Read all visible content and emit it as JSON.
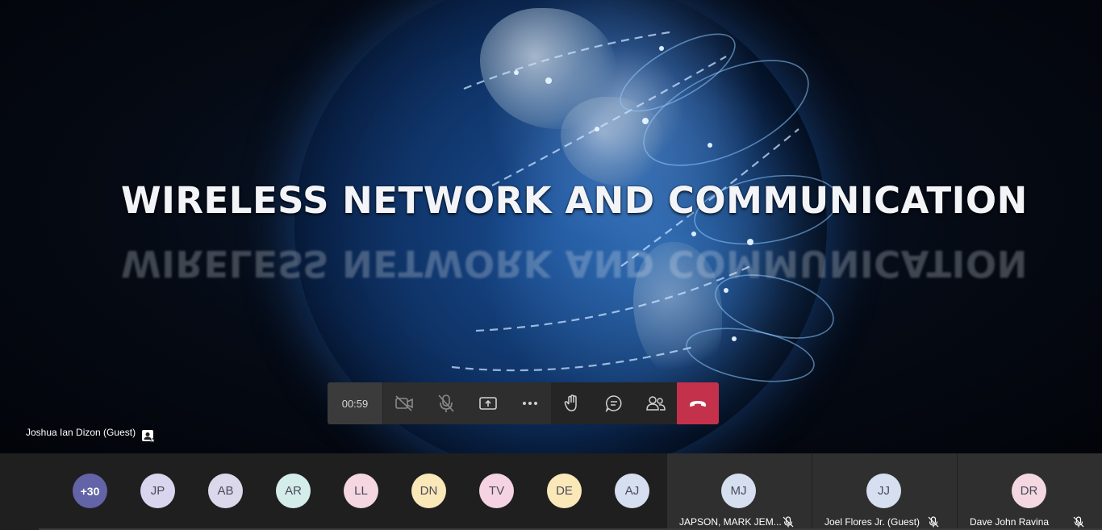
{
  "presentation": {
    "title": "WIRELESS NETWORK AND COMMUNICATION"
  },
  "controls": {
    "timer": "00:59",
    "buttons": [
      {
        "name": "camera-off-icon"
      },
      {
        "name": "mic-off-icon"
      },
      {
        "name": "share-screen-icon"
      },
      {
        "name": "more-options-icon"
      },
      {
        "name": "raise-hand-icon"
      },
      {
        "name": "chat-icon"
      },
      {
        "name": "participants-icon"
      },
      {
        "name": "hang-up-icon"
      }
    ],
    "hangup_color": "#c4314b"
  },
  "speaker": {
    "name": "Joshua Ian Dizon (Guest)"
  },
  "participants": {
    "overflow": "+30",
    "avatars": [
      {
        "initials": "JP",
        "color": "#d9d5ee"
      },
      {
        "initials": "AB",
        "color": "#dcd8ec"
      },
      {
        "initials": "AR",
        "color": "#d4ecea"
      },
      {
        "initials": "LL",
        "color": "#f4d7e0"
      },
      {
        "initials": "DN",
        "color": "#fbe8b8"
      },
      {
        "initials": "TV",
        "color": "#f5d3e2"
      },
      {
        "initials": "DE",
        "color": "#fbe8b8"
      },
      {
        "initials": "AJ",
        "color": "#d5dff0"
      }
    ],
    "tiles": [
      {
        "initials": "MJ",
        "name": "JAPSON, MARK JEM...",
        "color": "#d5dff0"
      },
      {
        "initials": "JJ",
        "name": "Joel Flores Jr. (Guest)",
        "color": "#d5dff0"
      },
      {
        "initials": "DR",
        "name": "Dave John Ravina",
        "color": "#f4d7e0"
      }
    ]
  }
}
